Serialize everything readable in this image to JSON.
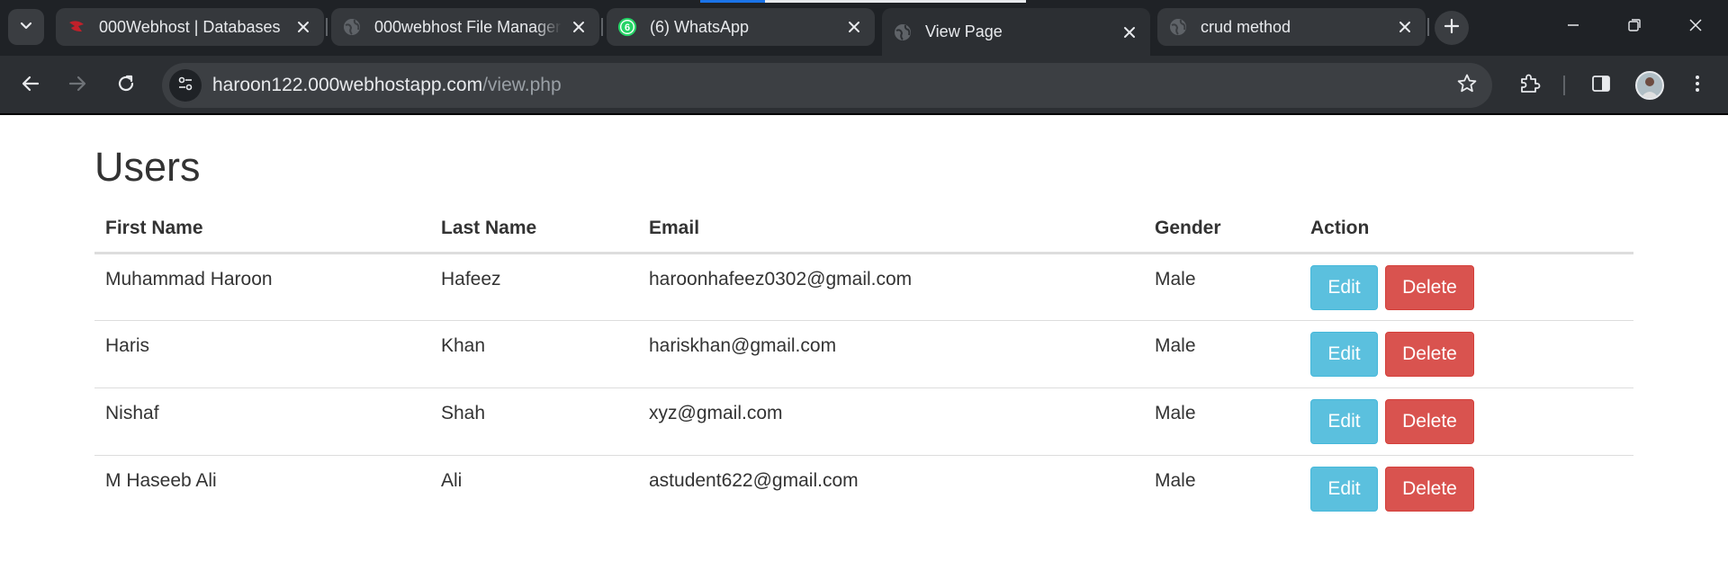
{
  "browser": {
    "tabs": [
      {
        "title": "000Webhost | Databases",
        "icon": "webhost-logo-icon",
        "active": false
      },
      {
        "title": "000webhost File Manager",
        "icon": "globe-icon",
        "active": false
      },
      {
        "title": "(6) WhatsApp",
        "icon": "whatsapp-icon",
        "badge": "6",
        "active": false
      },
      {
        "title": "View Page",
        "icon": "globe-icon",
        "active": true
      },
      {
        "title": "crud method",
        "icon": "globe-icon",
        "active": false
      }
    ],
    "url_host": "haroon122.000webhostapp.com",
    "url_path": "/view.php"
  },
  "page": {
    "title": "Users",
    "columns": [
      "First Name",
      "Last Name",
      "Email",
      "Gender",
      "Action"
    ],
    "rows": [
      {
        "first_name": "Muhammad Haroon",
        "last_name": "Hafeez",
        "email": "haroonhafeez0302@gmail.com",
        "gender": "Male"
      },
      {
        "first_name": "Haris",
        "last_name": "Khan",
        "email": "hariskhan@gmail.com",
        "gender": "Male"
      },
      {
        "first_name": "Nishaf",
        "last_name": "Shah",
        "email": "xyz@gmail.com",
        "gender": "Male"
      },
      {
        "first_name": "M Haseeb Ali",
        "last_name": "Ali",
        "email": "astudent622@gmail.com",
        "gender": "Male"
      }
    ],
    "edit_label": "Edit",
    "delete_label": "Delete"
  },
  "colors": {
    "edit_button": "#5bc0de",
    "delete_button": "#d9534f",
    "chrome_dark": "#1f2226",
    "whatsapp_green": "#25d366"
  }
}
